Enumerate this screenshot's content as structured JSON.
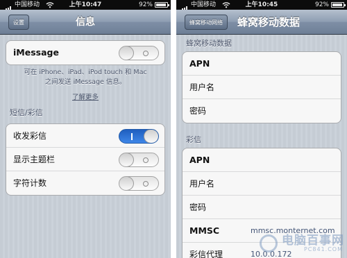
{
  "left": {
    "status": {
      "carrier": "中国移动",
      "time": "上午10:47",
      "battery": "92%",
      "battery_level": 0.92
    },
    "nav": {
      "back": "设置",
      "title": "信息"
    },
    "imessage": {
      "label": "iMessage",
      "on": false
    },
    "note": {
      "line1": "可在 iPhone、iPad、iPod touch 和 Mac",
      "line2": "之间发送 iMessage 信息。",
      "learn_more": "了解更多"
    },
    "section_sms": "短信/彩信",
    "rows": [
      {
        "label": "收发彩信",
        "on": true
      },
      {
        "label": "显示主题栏",
        "on": false
      },
      {
        "label": "字符计数",
        "on": false
      }
    ]
  },
  "right": {
    "status": {
      "carrier": "中国移动",
      "time": "上午10:45",
      "battery": "92%",
      "battery_level": 0.92
    },
    "nav": {
      "back": "蜂窝移动网络",
      "title": "蜂窝移动数据"
    },
    "section_cellular": "蜂窝移动数据",
    "cellular_rows": [
      {
        "label": "APN"
      },
      {
        "label": "用户名"
      },
      {
        "label": "密码"
      }
    ],
    "section_mms": "彩信",
    "mms_rows": [
      {
        "label": "APN",
        "value": ""
      },
      {
        "label": "用户名",
        "value": ""
      },
      {
        "label": "密码",
        "value": ""
      },
      {
        "label": "MMSC",
        "value": "mmsc.monternet.com"
      },
      {
        "label": "彩信代理",
        "value": "10.0.0.172"
      }
    ]
  },
  "watermark": {
    "text": "电脑百事网",
    "sub": "PC841.COM"
  }
}
